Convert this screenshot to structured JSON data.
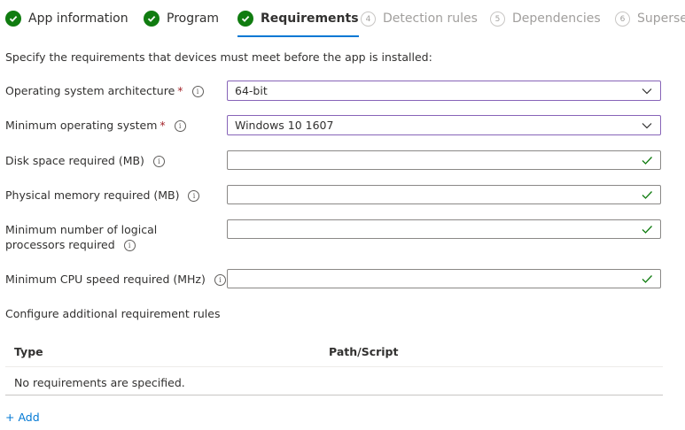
{
  "tabs": [
    {
      "label": "App information",
      "status": "done"
    },
    {
      "label": "Program",
      "status": "done"
    },
    {
      "label": "Requirements",
      "status": "active"
    },
    {
      "label": "Detection rules",
      "status": "disabled",
      "number": "4"
    },
    {
      "label": "Dependencies",
      "status": "disabled",
      "number": "5"
    },
    {
      "label": "Supersedence",
      "status": "disabled",
      "number": "6"
    }
  ],
  "intro": "Specify the requirements that devices must meet before the app is installed:",
  "fields": {
    "os_arch": {
      "label": "Operating system architecture",
      "value": "64-bit",
      "required": true
    },
    "min_os": {
      "label": "Minimum operating system",
      "value": "Windows 10 1607",
      "required": true
    },
    "disk_space": {
      "label": "Disk space required (MB)",
      "value": ""
    },
    "memory": {
      "label": "Physical memory required (MB)",
      "value": ""
    },
    "processors": {
      "label": "Minimum number of logical processors required",
      "value": ""
    },
    "cpu_speed": {
      "label": "Minimum CPU speed required (MHz)",
      "value": ""
    }
  },
  "additional_rules": {
    "label": "Configure additional requirement rules",
    "columns": [
      "Type",
      "Path/Script"
    ],
    "empty_text": "No requirements are specified.",
    "add_label": "+ Add"
  },
  "colors": {
    "accent": "#0078d4",
    "success": "#107c10",
    "required": "#a4262c",
    "select_border": "#8764b8"
  }
}
